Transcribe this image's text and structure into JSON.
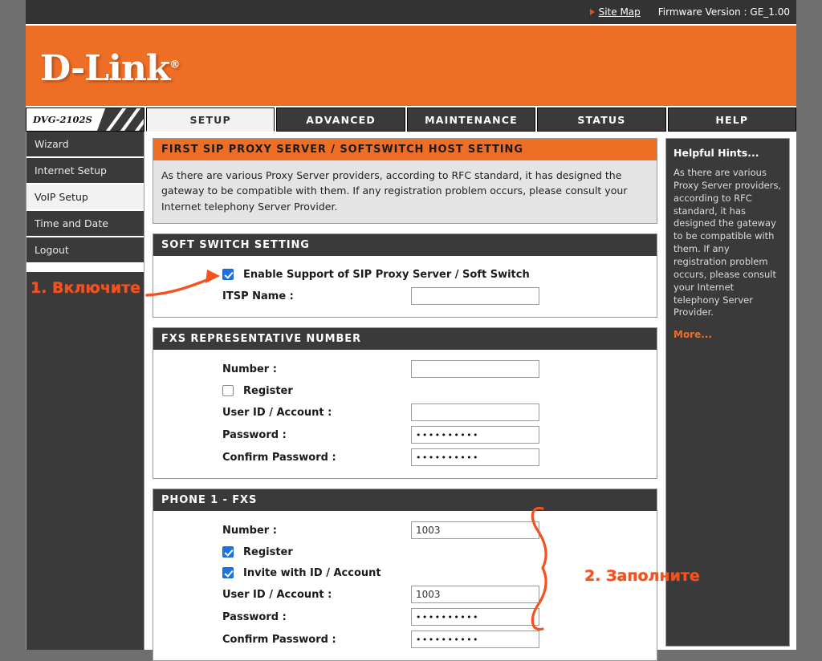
{
  "topbar": {
    "site_map_label": "Site Map",
    "site_map_icon": "triangle-right-icon",
    "firmware": "Firmware Version : GE_1.00"
  },
  "brand": {
    "logo_text": "D-Link",
    "registered_mark": "®"
  },
  "nav": {
    "model": "DVG-2102S",
    "tabs": [
      {
        "label": "SETUP",
        "active": true
      },
      {
        "label": "ADVANCED",
        "active": false
      },
      {
        "label": "MAINTENANCE",
        "active": false
      },
      {
        "label": "STATUS",
        "active": false
      },
      {
        "label": "HELP",
        "active": false
      }
    ]
  },
  "sidebar": {
    "items": [
      {
        "label": "Wizard",
        "active": false
      },
      {
        "label": "Internet Setup",
        "active": false
      },
      {
        "label": "VoIP Setup",
        "active": true
      },
      {
        "label": "Time and Date",
        "active": false
      },
      {
        "label": "Logout",
        "active": false
      }
    ]
  },
  "main": {
    "header": "FIRST SIP PROXY SERVER / SOFTSWITCH HOST SETTING",
    "description": "As there are various Proxy Server providers, according to RFC standard, it has designed the gateway to be compatible with them. If any registration problem occurs, please consult your Internet telephony Server Provider.",
    "soft_switch": {
      "header": "SOFT SWITCH SETTING",
      "enable_label": "Enable Support of SIP Proxy Server / Soft Switch",
      "enable_checked": true,
      "itsp_label": "ITSP Name :",
      "itsp_value": "",
      "itsp_placeholder": ""
    },
    "fxs_representative": {
      "header": "FXS REPRESENTATIVE NUMBER",
      "number_label": "Number :",
      "number_value": "",
      "register_label": "Register",
      "register_checked": false,
      "userid_label": "User ID / Account :",
      "userid_value": "",
      "password_label": "Password :",
      "password_value": "••••••••••",
      "confirm_label": "Confirm Password :",
      "confirm_value": "••••••••••"
    },
    "phone1_fxs": {
      "header": "PHONE 1 - FXS",
      "number_label": "Number :",
      "number_value": "1003",
      "register_label": "Register",
      "register_checked": true,
      "invite_label": "Invite with ID / Account",
      "invite_checked": true,
      "userid_label": "User ID / Account :",
      "userid_value": "1003",
      "password_label": "Password :",
      "password_value": "••••••••••",
      "confirm_label": "Confirm Password :",
      "confirm_value": "••••••••••"
    }
  },
  "hints": {
    "title": "Helpful Hints...",
    "text": "As there are various Proxy Server providers, according to RFC standard, it has designed the gateway to be compatible with them. If any registration problem occurs, please consult your Internet telephony Server Provider.",
    "more_label": "More..."
  },
  "annotations": {
    "step1": "1. Включите",
    "step2": "2. Заполните",
    "color": "#f4511e"
  }
}
